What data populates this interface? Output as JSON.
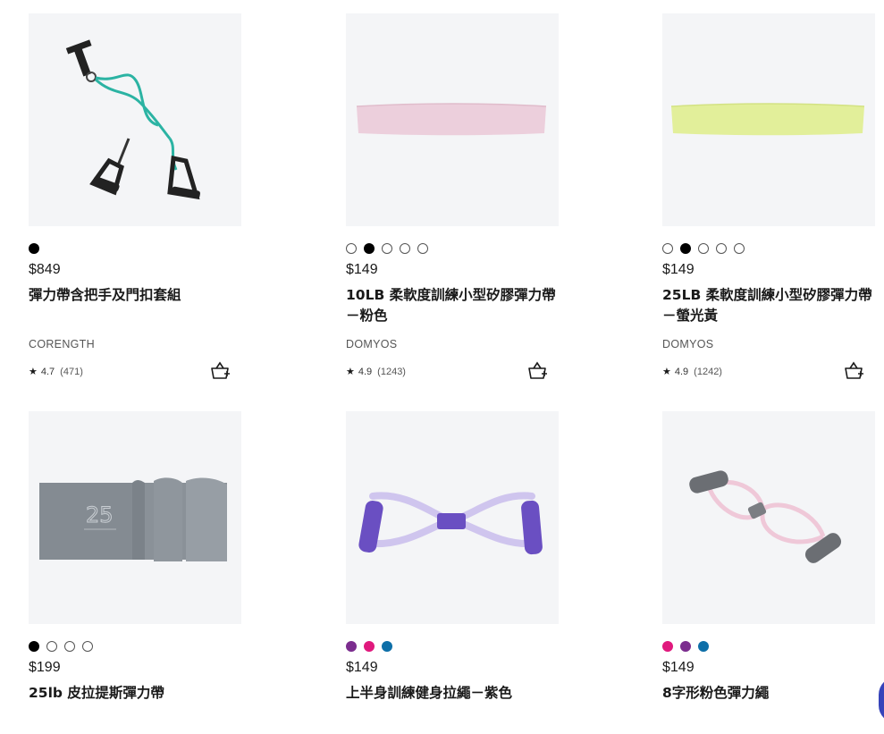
{
  "products": [
    {
      "price": "$849",
      "title": "彈力帶含把手及門扣套組",
      "brand": "CORENGTH",
      "rating": "4.7",
      "reviews": "(471)",
      "swatches": [
        {
          "color": "#000000",
          "filled": true
        }
      ],
      "image_icon": "resistance-tube-with-handles"
    },
    {
      "price": "$149",
      "title": "10LB 柔軟度訓練小型矽膠彈力帶－粉色",
      "brand": "DOMYOS",
      "rating": "4.9",
      "reviews": "(1243)",
      "swatches": [
        {
          "color": "#ffffff",
          "filled": false
        },
        {
          "color": "#000000",
          "filled": true
        },
        {
          "color": "#ffffff",
          "filled": false
        },
        {
          "color": "#ffffff",
          "filled": false
        },
        {
          "color": "#ffffff",
          "filled": false
        }
      ],
      "image_icon": "pink-mini-band"
    },
    {
      "price": "$149",
      "title": "25LB 柔軟度訓練小型矽膠彈力帶－螢光黃",
      "brand": "DOMYOS",
      "rating": "4.9",
      "reviews": "(1242)",
      "swatches": [
        {
          "color": "#ffffff",
          "filled": false
        },
        {
          "color": "#000000",
          "filled": true
        },
        {
          "color": "#ffffff",
          "filled": false
        },
        {
          "color": "#ffffff",
          "filled": false
        },
        {
          "color": "#ffffff",
          "filled": false
        }
      ],
      "image_icon": "yellow-mini-band"
    },
    {
      "price": "$199",
      "title": "25lb 皮拉提斯彈力帶",
      "swatches": [
        {
          "color": "#000000",
          "filled": true
        },
        {
          "color": "#ffffff",
          "filled": false
        },
        {
          "color": "#ffffff",
          "filled": false
        },
        {
          "color": "#ffffff",
          "filled": false
        }
      ],
      "image_icon": "grey-pilates-band",
      "image_text": "25"
    },
    {
      "price": "$149",
      "title": "上半身訓練健身拉繩－紫色",
      "swatches": [
        {
          "color": "#7b2d8e",
          "filled": true
        },
        {
          "color": "#e0197d",
          "filled": true
        },
        {
          "color": "#0e6fa8",
          "filled": true
        }
      ],
      "image_icon": "purple-figure8-expander"
    },
    {
      "price": "$149",
      "title": "8字形粉色彈力繩",
      "swatches": [
        {
          "color": "#e0197d",
          "filled": true
        },
        {
          "color": "#7b2d8e",
          "filled": true
        },
        {
          "color": "#0e6fa8",
          "filled": true
        }
      ],
      "image_icon": "pink-figure8-expander"
    }
  ],
  "colors": {
    "image_bg": "#f4f5f7",
    "accent": "#3643ba"
  }
}
